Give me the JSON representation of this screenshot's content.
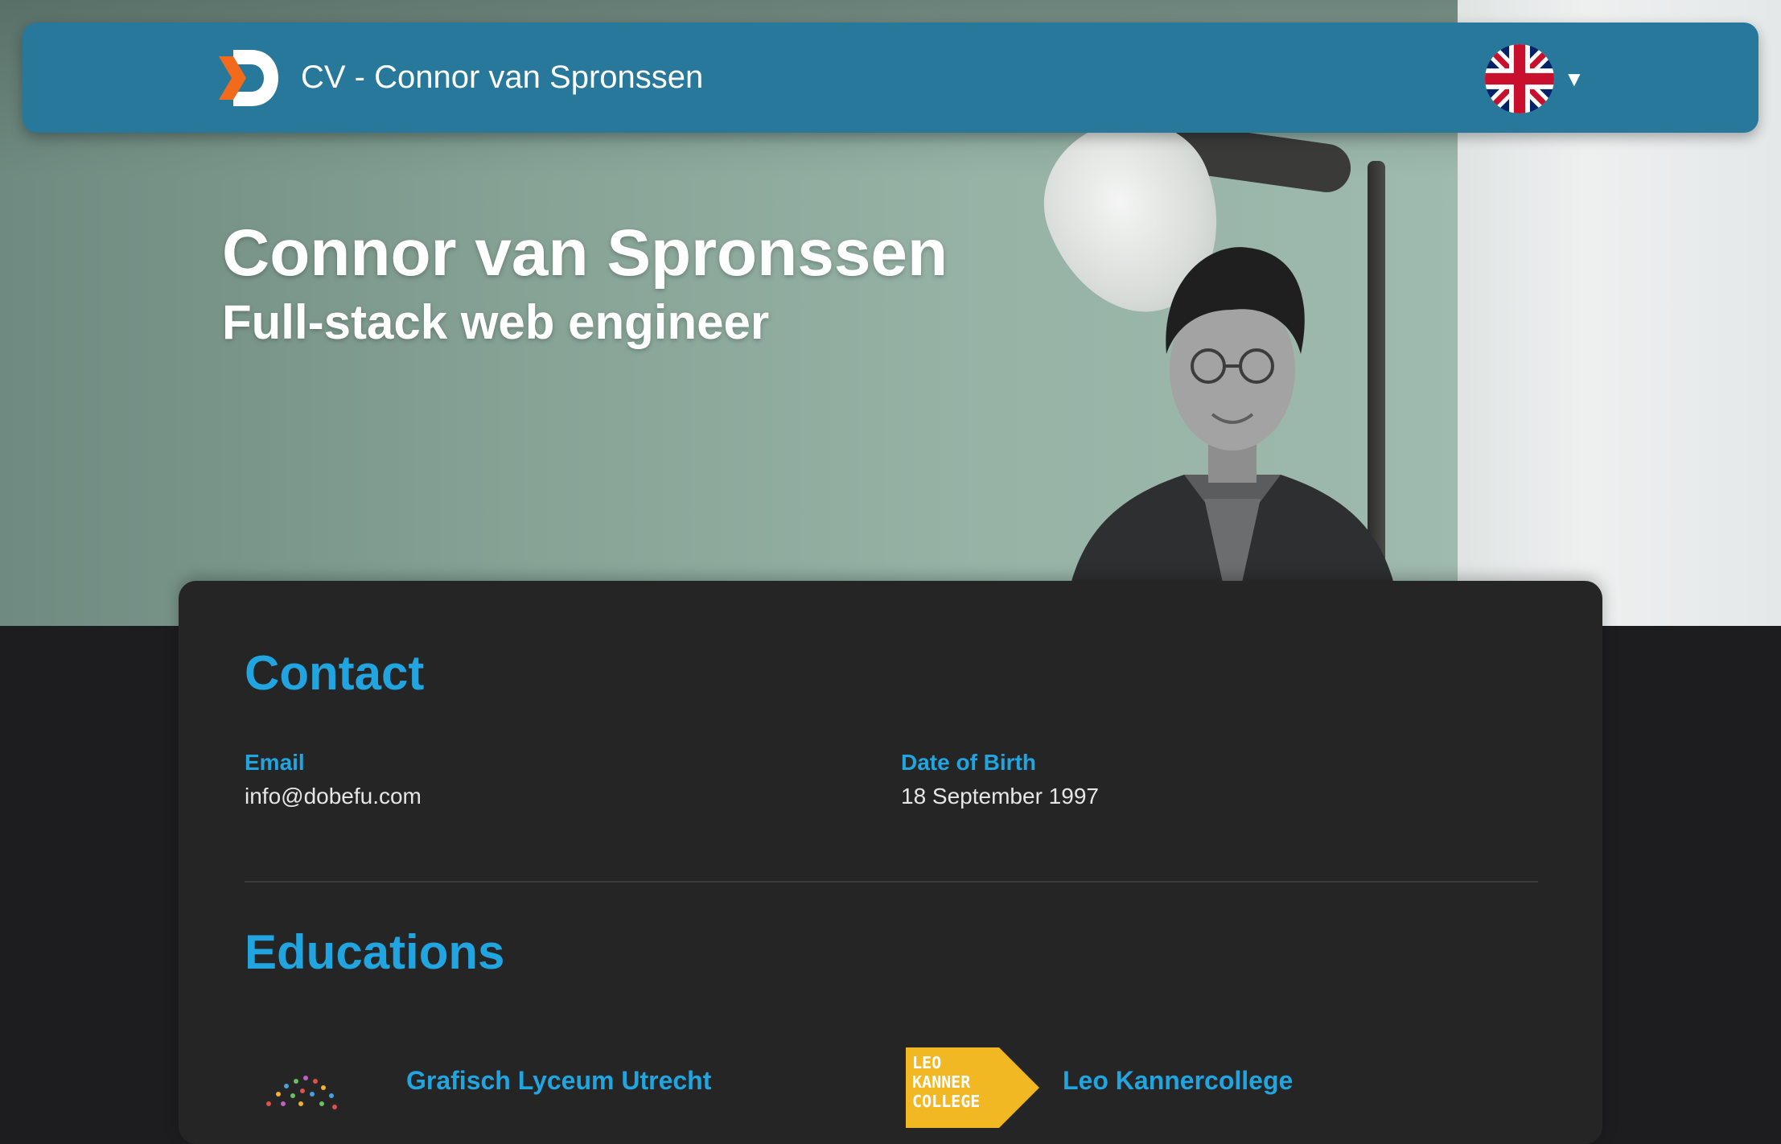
{
  "navbar": {
    "title": "CV - Connor van Spronssen",
    "logo_icon": "dobefu-logo-icon",
    "language_flag": "uk-flag-icon",
    "caret_icon": "caret-down-icon"
  },
  "hero": {
    "name": "Connor van Spronssen",
    "title": "Full-stack web engineer"
  },
  "contact": {
    "heading": "Contact",
    "email_label": "Email",
    "email_value": "info@dobefu.com",
    "dob_label": "Date of Birth",
    "dob_value": "18 September 1997"
  },
  "educations": {
    "heading": "Educations",
    "items": [
      {
        "name": "Grafisch Lyceum Utrecht",
        "logo_icon": "grafisch-lyceum-logo-icon"
      },
      {
        "name": "Leo Kannercollege",
        "logo_icon": "leo-kannercollege-logo-icon",
        "logo_text": "LEO KANNER COLLEGE"
      }
    ]
  },
  "colors": {
    "navbar": "#27789a",
    "accent": "#21a5e0",
    "card": "#252525",
    "page": "#1d1d1f"
  }
}
